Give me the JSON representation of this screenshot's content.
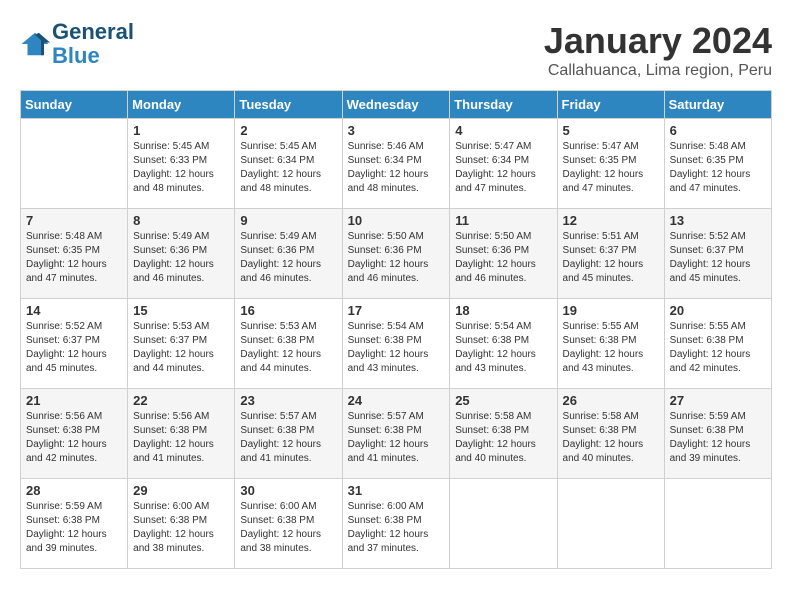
{
  "logo": {
    "line1": "General",
    "line2": "Blue"
  },
  "title": "January 2024",
  "subtitle": "Callahuanca, Lima region, Peru",
  "days_of_week": [
    "Sunday",
    "Monday",
    "Tuesday",
    "Wednesday",
    "Thursday",
    "Friday",
    "Saturday"
  ],
  "weeks": [
    [
      {
        "day": "",
        "sunrise": "",
        "sunset": "",
        "daylight": ""
      },
      {
        "day": "1",
        "sunrise": "Sunrise: 5:45 AM",
        "sunset": "Sunset: 6:33 PM",
        "daylight": "Daylight: 12 hours and 48 minutes."
      },
      {
        "day": "2",
        "sunrise": "Sunrise: 5:45 AM",
        "sunset": "Sunset: 6:34 PM",
        "daylight": "Daylight: 12 hours and 48 minutes."
      },
      {
        "day": "3",
        "sunrise": "Sunrise: 5:46 AM",
        "sunset": "Sunset: 6:34 PM",
        "daylight": "Daylight: 12 hours and 48 minutes."
      },
      {
        "day": "4",
        "sunrise": "Sunrise: 5:47 AM",
        "sunset": "Sunset: 6:34 PM",
        "daylight": "Daylight: 12 hours and 47 minutes."
      },
      {
        "day": "5",
        "sunrise": "Sunrise: 5:47 AM",
        "sunset": "Sunset: 6:35 PM",
        "daylight": "Daylight: 12 hours and 47 minutes."
      },
      {
        "day": "6",
        "sunrise": "Sunrise: 5:48 AM",
        "sunset": "Sunset: 6:35 PM",
        "daylight": "Daylight: 12 hours and 47 minutes."
      }
    ],
    [
      {
        "day": "7",
        "sunrise": "Sunrise: 5:48 AM",
        "sunset": "Sunset: 6:35 PM",
        "daylight": "Daylight: 12 hours and 47 minutes."
      },
      {
        "day": "8",
        "sunrise": "Sunrise: 5:49 AM",
        "sunset": "Sunset: 6:36 PM",
        "daylight": "Daylight: 12 hours and 46 minutes."
      },
      {
        "day": "9",
        "sunrise": "Sunrise: 5:49 AM",
        "sunset": "Sunset: 6:36 PM",
        "daylight": "Daylight: 12 hours and 46 minutes."
      },
      {
        "day": "10",
        "sunrise": "Sunrise: 5:50 AM",
        "sunset": "Sunset: 6:36 PM",
        "daylight": "Daylight: 12 hours and 46 minutes."
      },
      {
        "day": "11",
        "sunrise": "Sunrise: 5:50 AM",
        "sunset": "Sunset: 6:36 PM",
        "daylight": "Daylight: 12 hours and 46 minutes."
      },
      {
        "day": "12",
        "sunrise": "Sunrise: 5:51 AM",
        "sunset": "Sunset: 6:37 PM",
        "daylight": "Daylight: 12 hours and 45 minutes."
      },
      {
        "day": "13",
        "sunrise": "Sunrise: 5:52 AM",
        "sunset": "Sunset: 6:37 PM",
        "daylight": "Daylight: 12 hours and 45 minutes."
      }
    ],
    [
      {
        "day": "14",
        "sunrise": "Sunrise: 5:52 AM",
        "sunset": "Sunset: 6:37 PM",
        "daylight": "Daylight: 12 hours and 45 minutes."
      },
      {
        "day": "15",
        "sunrise": "Sunrise: 5:53 AM",
        "sunset": "Sunset: 6:37 PM",
        "daylight": "Daylight: 12 hours and 44 minutes."
      },
      {
        "day": "16",
        "sunrise": "Sunrise: 5:53 AM",
        "sunset": "Sunset: 6:38 PM",
        "daylight": "Daylight: 12 hours and 44 minutes."
      },
      {
        "day": "17",
        "sunrise": "Sunrise: 5:54 AM",
        "sunset": "Sunset: 6:38 PM",
        "daylight": "Daylight: 12 hours and 43 minutes."
      },
      {
        "day": "18",
        "sunrise": "Sunrise: 5:54 AM",
        "sunset": "Sunset: 6:38 PM",
        "daylight": "Daylight: 12 hours and 43 minutes."
      },
      {
        "day": "19",
        "sunrise": "Sunrise: 5:55 AM",
        "sunset": "Sunset: 6:38 PM",
        "daylight": "Daylight: 12 hours and 43 minutes."
      },
      {
        "day": "20",
        "sunrise": "Sunrise: 5:55 AM",
        "sunset": "Sunset: 6:38 PM",
        "daylight": "Daylight: 12 hours and 42 minutes."
      }
    ],
    [
      {
        "day": "21",
        "sunrise": "Sunrise: 5:56 AM",
        "sunset": "Sunset: 6:38 PM",
        "daylight": "Daylight: 12 hours and 42 minutes."
      },
      {
        "day": "22",
        "sunrise": "Sunrise: 5:56 AM",
        "sunset": "Sunset: 6:38 PM",
        "daylight": "Daylight: 12 hours and 41 minutes."
      },
      {
        "day": "23",
        "sunrise": "Sunrise: 5:57 AM",
        "sunset": "Sunset: 6:38 PM",
        "daylight": "Daylight: 12 hours and 41 minutes."
      },
      {
        "day": "24",
        "sunrise": "Sunrise: 5:57 AM",
        "sunset": "Sunset: 6:38 PM",
        "daylight": "Daylight: 12 hours and 41 minutes."
      },
      {
        "day": "25",
        "sunrise": "Sunrise: 5:58 AM",
        "sunset": "Sunset: 6:38 PM",
        "daylight": "Daylight: 12 hours and 40 minutes."
      },
      {
        "day": "26",
        "sunrise": "Sunrise: 5:58 AM",
        "sunset": "Sunset: 6:38 PM",
        "daylight": "Daylight: 12 hours and 40 minutes."
      },
      {
        "day": "27",
        "sunrise": "Sunrise: 5:59 AM",
        "sunset": "Sunset: 6:38 PM",
        "daylight": "Daylight: 12 hours and 39 minutes."
      }
    ],
    [
      {
        "day": "28",
        "sunrise": "Sunrise: 5:59 AM",
        "sunset": "Sunset: 6:38 PM",
        "daylight": "Daylight: 12 hours and 39 minutes."
      },
      {
        "day": "29",
        "sunrise": "Sunrise: 6:00 AM",
        "sunset": "Sunset: 6:38 PM",
        "daylight": "Daylight: 12 hours and 38 minutes."
      },
      {
        "day": "30",
        "sunrise": "Sunrise: 6:00 AM",
        "sunset": "Sunset: 6:38 PM",
        "daylight": "Daylight: 12 hours and 38 minutes."
      },
      {
        "day": "31",
        "sunrise": "Sunrise: 6:00 AM",
        "sunset": "Sunset: 6:38 PM",
        "daylight": "Daylight: 12 hours and 37 minutes."
      },
      {
        "day": "",
        "sunrise": "",
        "sunset": "",
        "daylight": ""
      },
      {
        "day": "",
        "sunrise": "",
        "sunset": "",
        "daylight": ""
      },
      {
        "day": "",
        "sunrise": "",
        "sunset": "",
        "daylight": ""
      }
    ]
  ]
}
